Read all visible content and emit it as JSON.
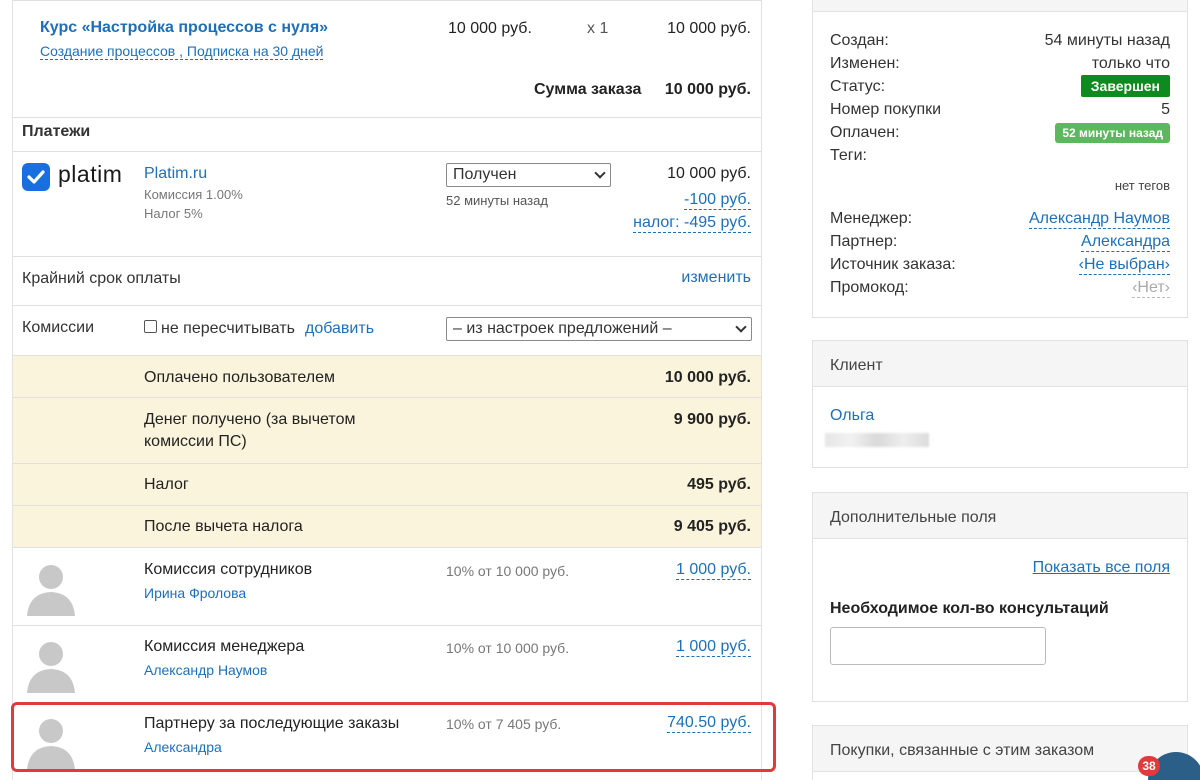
{
  "order_item": {
    "title": "Курс «Настройка процессов с нуля»",
    "subtitle": "Создание процессов , Подписка на 30 дней",
    "price": "10 000 руб.",
    "qty": "x 1",
    "total": "10 000 руб."
  },
  "order_sum": {
    "label": "Сумма заказа",
    "value": "10 000 руб."
  },
  "payments": {
    "heading": "Платежи",
    "logo_text": "platim",
    "system_name": "Platim.ru",
    "commission_note": "Комиссия 1.00%",
    "tax_note": "Налог 5%",
    "status_selected": "Получен",
    "status_time": "52 минуты назад",
    "amount": "10 000 руб.",
    "fee": "-100 руб.",
    "tax": "налог: -495 руб."
  },
  "deadline": {
    "label": "Крайний срок оплаты",
    "action": "изменить"
  },
  "commissions": {
    "label": "Комиссии",
    "checkbox_label": "не пересчитывать",
    "add_link": "добавить",
    "select_value": "– из настроек предложений –"
  },
  "summary": [
    {
      "label": "Оплачено пользователем",
      "value": "10 000 руб."
    },
    {
      "label": "Денег получено (за вычетом комиссии ПС)",
      "value": "9 900 руб."
    },
    {
      "label": "Налог",
      "value": "495 руб."
    },
    {
      "label": "После вычета налога",
      "value": "9 405 руб."
    }
  ],
  "commission_rows": [
    {
      "title": "Комиссия сотрудников",
      "person": "Ирина Фролова",
      "basis": "10% от 10 000 руб.",
      "amount": "1 000 руб."
    },
    {
      "title": "Комиссия менеджера",
      "person": "Александр Наумов",
      "basis": "10% от 10 000 руб.",
      "amount": "1 000 руб."
    },
    {
      "title": "Партнеру за последующие заказы",
      "person": "Александра",
      "basis": "10% от 7 405 руб.",
      "amount": "740.50 руб."
    }
  ],
  "info": {
    "created_label": "Создан:",
    "created_value": "54 минуты назад",
    "changed_label": "Изменен:",
    "changed_value": "только что",
    "status_label": "Статус:",
    "status_value": "Завершен",
    "purchase_label": "Номер покупки",
    "purchase_value": "5",
    "paid_label": "Оплачен:",
    "paid_value": "52 минуты назад",
    "tags_label": "Теги:",
    "tags_value": "нет тегов",
    "manager_label": "Менеджер:",
    "manager_value": "Александр Наумов",
    "partner_label": "Партнер:",
    "partner_value": "Александра",
    "source_label": "Источник заказа:",
    "source_value": "‹Не выбран›",
    "promo_label": "Промокод:",
    "promo_value": "‹Нет›"
  },
  "client": {
    "heading": "Клиент",
    "name": "Ольга"
  },
  "extra_fields": {
    "heading": "Дополнительные поля",
    "show_all": "Показать все поля",
    "field_label": "Необходимое кол-во консультаций",
    "field_value": ""
  },
  "related": {
    "heading": "Покупки, связанные с этим заказом"
  },
  "chat_badge": "38",
  "colors": {
    "link": "#1e6fb8",
    "highlight": "#e03a3a",
    "status_green": "#0f8a1f",
    "paid_green": "#5cb85c",
    "summary_bg": "#fbf4dc"
  }
}
